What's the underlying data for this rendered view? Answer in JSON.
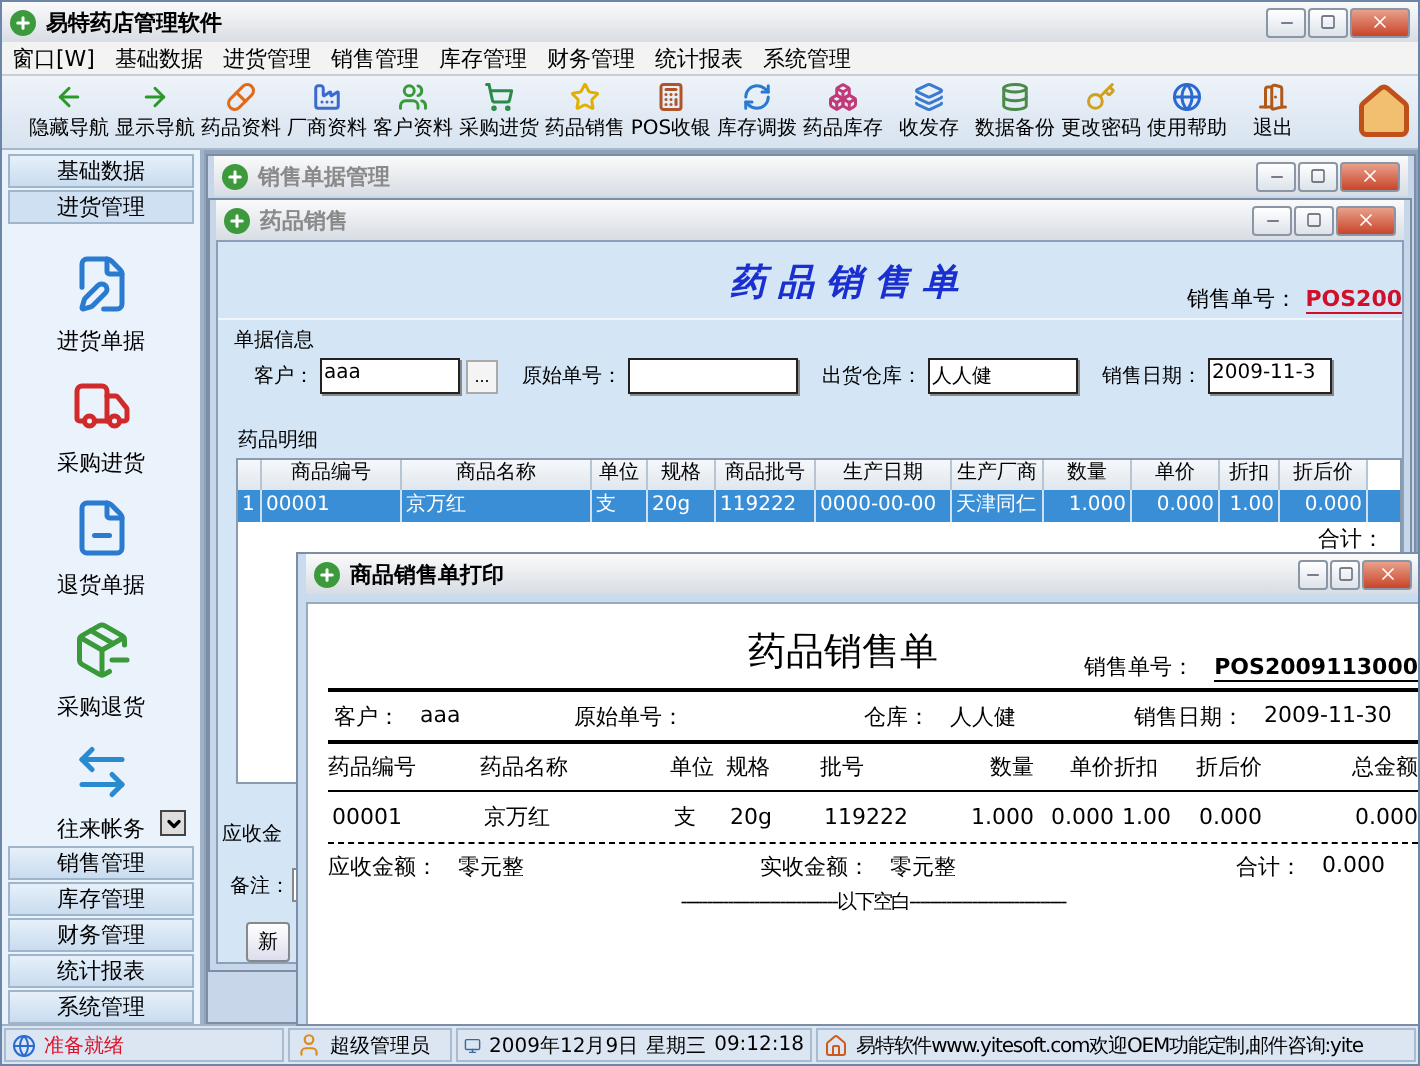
{
  "window": {
    "title": "易特药店管理软件"
  },
  "menu": [
    "窗口[W]",
    "基础数据",
    "进货管理",
    "销售管理",
    "库存管理",
    "财务管理",
    "统计报表",
    "系统管理"
  ],
  "toolbar": [
    "隐藏导航",
    "显示导航",
    "药品资料",
    "厂商资料",
    "客户资料",
    "采购进货",
    "药品销售",
    "POS收银",
    "库存调拨",
    "药品库存",
    "收发存",
    "数据备份",
    "更改密码",
    "使用帮助",
    "退出"
  ],
  "sidebar": [
    {
      "label": "基础数据",
      "expanded": false
    },
    {
      "label": "进货管理",
      "expanded": true,
      "items": [
        "进货单据",
        "采购进货",
        "退货单据",
        "采购退货",
        "往来帐务"
      ]
    },
    {
      "label": "销售管理",
      "expanded": false
    },
    {
      "label": "库存管理",
      "expanded": false
    },
    {
      "label": "财务管理",
      "expanded": false
    },
    {
      "label": "统计报表",
      "expanded": false
    },
    {
      "label": "系统管理",
      "expanded": false
    }
  ],
  "manager_window": {
    "title": "销售单据管理"
  },
  "sales_window": {
    "title": "药品销售",
    "heading": "药品销售单",
    "order_no_label": "销售单号：",
    "order_no": "POS200",
    "group_title": "单据信息",
    "fields": [
      {
        "label": "客户：",
        "value": "aaa",
        "kind": "picker",
        "picker_label": "..."
      },
      {
        "label": "原始单号：",
        "kind": "text"
      },
      {
        "label": "出货仓库：",
        "value": "人人健",
        "kind": "text"
      },
      {
        "label": "销售日期：",
        "value": "2009-11-3",
        "kind": "text"
      }
    ],
    "detail_title": "药品明细",
    "columns": [
      "商品编号",
      "商品名称",
      "单位",
      "规格",
      "商品批号",
      "生产日期",
      "生产厂商",
      "数量",
      "单价",
      "折扣",
      "折后价"
    ],
    "rows": [
      {
        "number": "1",
        "selected": true,
        "cells": [
          "00001",
          "京万红",
          "支",
          "20g",
          "119222",
          "0000-00-00",
          "天津同仁",
          "1.000",
          "0.000",
          "1.00",
          "0.000"
        ]
      }
    ],
    "total_label": "合计：",
    "receivable_label": "应收金",
    "remark_label": "备注：",
    "new_button": "新"
  },
  "print_window": {
    "title": "商品销售单打印",
    "heading": "药品销售单",
    "order_no_label": "销售单号：",
    "order_no": "POS2009113000",
    "info": [
      {
        "label": "客户：",
        "value": "aaa"
      },
      {
        "label": "原始单号："
      },
      {
        "label": "仓库：",
        "value": "人人健"
      },
      {
        "label": "销售日期：",
        "value": "2009-11-30"
      }
    ],
    "columns": [
      "药品编号",
      "药品名称",
      "单位",
      "规格",
      "批号",
      "数量",
      "单价",
      "折扣",
      "折后价",
      "总金额"
    ],
    "rows": [
      [
        "00001",
        "京万红",
        "支",
        "20g",
        "119222",
        "1.000",
        "0.000",
        "1.00",
        "0.000",
        "0.000"
      ]
    ],
    "summary": [
      {
        "label": "应收金额：",
        "value": "零元整"
      },
      {
        "label": "实收金额：",
        "value": "零元整"
      },
      {
        "label": "合计：",
        "value": "0.000"
      }
    ],
    "blank_note": "------------------------------以下空白------------------------------"
  },
  "status_bar": {
    "status": "准备就绪",
    "user": "超级管理员",
    "date": "2009年12月9日",
    "weekday": "星期三",
    "time": "09:12:18",
    "notice": "易特软件www.yitesoft.com欢迎OEM功能定制,邮件咨询:yite"
  }
}
